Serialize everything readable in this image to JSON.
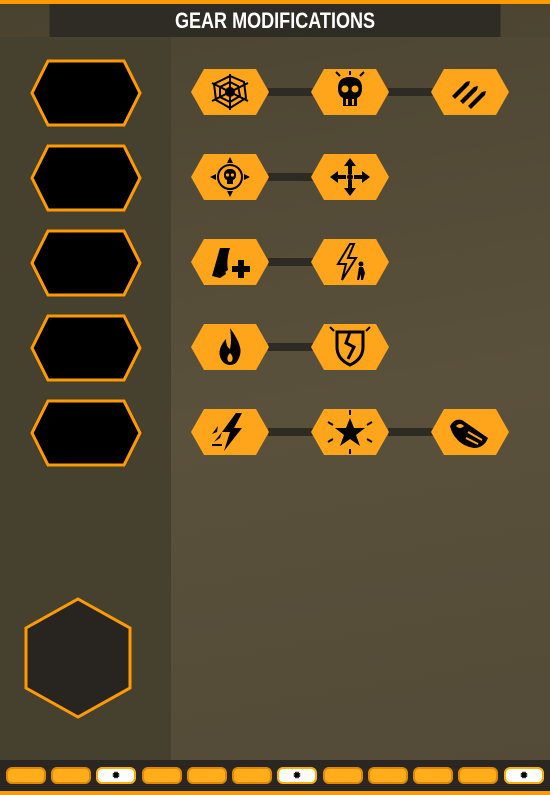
{
  "header": {
    "title": "GEAR MODIFICATIONS"
  },
  "colors": {
    "accent": "#ff9a00",
    "node_fill": "#ffa51c",
    "slot_fill": "#000000",
    "connector": "#2e2b24",
    "panel_dark": "#2f2c26"
  },
  "slots": [
    {
      "name": "gear-slot-1"
    },
    {
      "name": "gear-slot-2"
    },
    {
      "name": "gear-slot-3"
    },
    {
      "name": "gear-slot-4"
    },
    {
      "name": "gear-slot-5"
    }
  ],
  "main_slot": {
    "name": "main-gear-slot"
  },
  "mod_rows": [
    {
      "nodes": [
        {
          "icon": "spider-web-icon"
        },
        {
          "icon": "skull-icon"
        },
        {
          "icon": "bullets-icon"
        }
      ]
    },
    {
      "nodes": [
        {
          "icon": "target-skull-icon"
        },
        {
          "icon": "move-arrows-icon"
        }
      ]
    },
    {
      "nodes": [
        {
          "icon": "ammo-plus-icon"
        },
        {
          "icon": "lightning-runner-icon"
        }
      ]
    },
    {
      "nodes": [
        {
          "icon": "fire-icon"
        },
        {
          "icon": "broken-shield-icon"
        }
      ]
    },
    {
      "nodes": [
        {
          "icon": "lightning-strike-icon"
        },
        {
          "icon": "star-burst-icon"
        },
        {
          "icon": "flame-burst-icon"
        }
      ]
    }
  ],
  "bottom_bar": {
    "pills": [
      {
        "active": false
      },
      {
        "active": false
      },
      {
        "active": true,
        "icon": "burst-icon"
      },
      {
        "active": false
      },
      {
        "active": false
      },
      {
        "active": false
      },
      {
        "active": true,
        "icon": "burst-icon"
      },
      {
        "active": false
      },
      {
        "active": false
      },
      {
        "active": false
      },
      {
        "active": false
      },
      {
        "active": true,
        "icon": "burst-icon"
      }
    ]
  }
}
